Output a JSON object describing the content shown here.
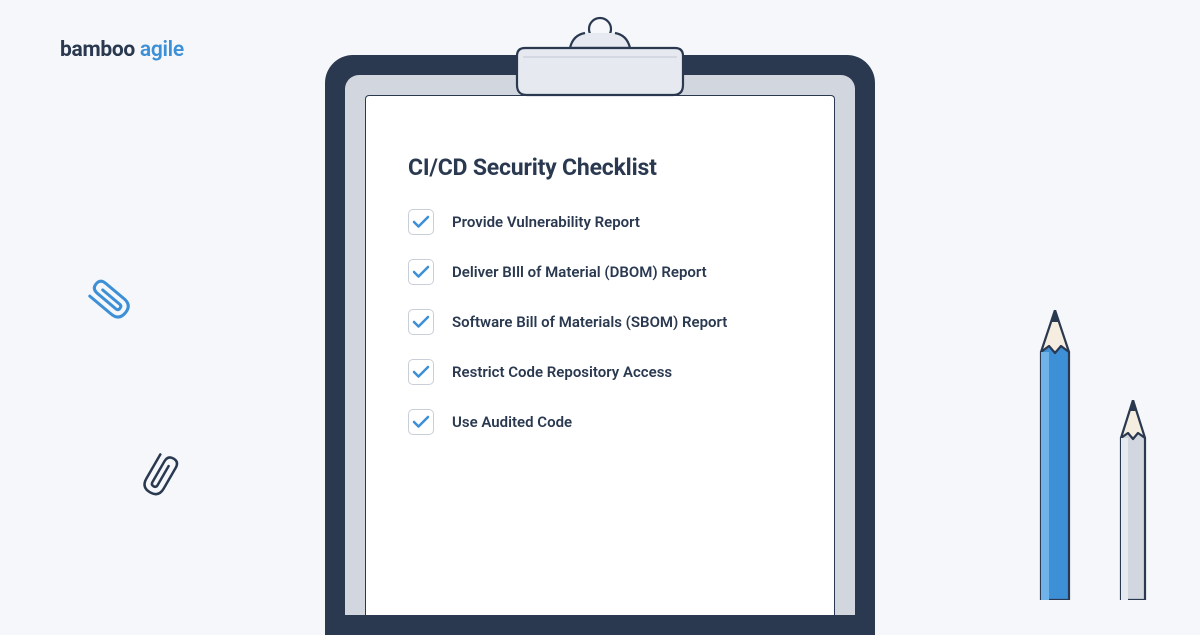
{
  "brand": {
    "word1": "bamboo",
    "word2": "agile"
  },
  "checklist": {
    "title": "CI/CD Security Checklist",
    "items": [
      {
        "label": "Provide Vulnerability Report"
      },
      {
        "label": "Deliver BIll of Material (DBOM) Report"
      },
      {
        "label": "Software Bill of Materials (SBOM) Report"
      },
      {
        "label": "Restrict Code Repository Access"
      },
      {
        "label": "Use Audited Code"
      }
    ]
  }
}
